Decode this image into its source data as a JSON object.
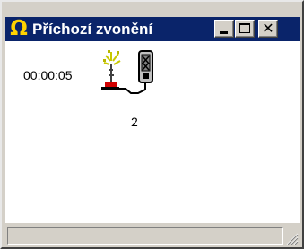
{
  "window": {
    "title": "Příchozí zvonění",
    "title_icon": "omega-icon",
    "title_icon_glyph": "Ω",
    "controls": {
      "minimize_icon": "minimize-icon",
      "maximize_icon": "maximize-icon",
      "close_icon": "close-icon",
      "close_glyph": "✕"
    }
  },
  "call": {
    "elapsed_time": "00:00:05",
    "line_number": "2",
    "icon": "ringing-phone-icon"
  },
  "statusbar": {
    "text": ""
  },
  "colors": {
    "title_bar": "#0a246a",
    "title_icon": "#ffd200",
    "window_face": "#d4d0c8",
    "client_background": "#ffffff"
  }
}
